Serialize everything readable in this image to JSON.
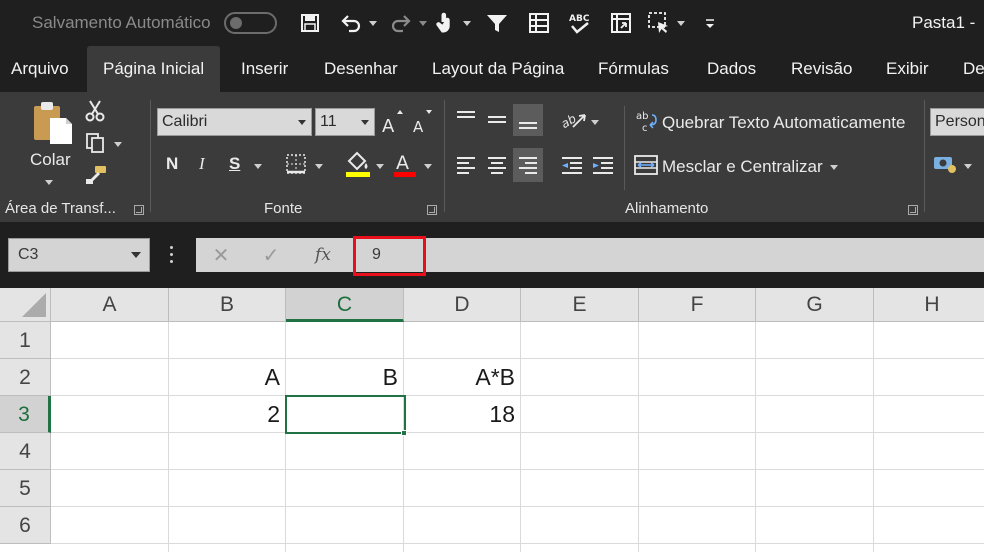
{
  "titlebar": {
    "autosave_label": "Salvamento Automático",
    "autosave_on": false,
    "window_title": "Pasta1  -",
    "icons": [
      "save-icon",
      "undo-icon",
      "redo-icon",
      "touch-mode-icon",
      "filter-icon",
      "form-icon",
      "spelling-icon",
      "pivot-icon",
      "select-objects-icon",
      "customize-qat-icon"
    ]
  },
  "tabs": [
    {
      "label": "Arquivo",
      "active": false
    },
    {
      "label": "Página Inicial",
      "active": true
    },
    {
      "label": "Inserir",
      "active": false
    },
    {
      "label": "Desenhar",
      "active": false
    },
    {
      "label": "Layout da Página",
      "active": false
    },
    {
      "label": "Fórmulas",
      "active": false
    },
    {
      "label": "Dados",
      "active": false
    },
    {
      "label": "Revisão",
      "active": false
    },
    {
      "label": "Exibir",
      "active": false
    },
    {
      "label": "De",
      "active": false
    }
  ],
  "ribbon": {
    "clipboard": {
      "paste_label": "Colar",
      "group_label": "Área de Transf..."
    },
    "font": {
      "font_name": "Calibri",
      "font_size": "11",
      "bold": "N",
      "italic": "I",
      "underline": "S",
      "group_label": "Fonte",
      "fill_color": "#ffff00",
      "font_color": "#ff0000"
    },
    "alignment": {
      "wrap_label": "Quebrar Texto Automaticamente",
      "merge_label": "Mesclar e Centralizar",
      "group_label": "Alinhamento",
      "wrap_icon_text": "ab\nc"
    },
    "number": {
      "format_value": "Person"
    }
  },
  "formula_bar": {
    "name_box": "C3",
    "cancel_symbol": "✕",
    "enter_symbol": "✓",
    "fx_label": "fx",
    "formula": "9"
  },
  "sheet": {
    "columns": [
      "A",
      "B",
      "C",
      "D",
      "E",
      "F",
      "G",
      "H"
    ],
    "rows": [
      "1",
      "2",
      "3",
      "4",
      "5",
      "6"
    ],
    "selected_column": "C",
    "selected_row": "3",
    "active_cell": "C3",
    "cells": {
      "B2": "A",
      "C2": "B",
      "D2": "A*B",
      "B3": "2",
      "C3": "",
      "D3": "18"
    }
  },
  "colors": {
    "accent_green": "#217346",
    "highlight_red": "#e8101a",
    "chrome_dark": "#1f1f1f",
    "ribbon": "#3b3b3b"
  }
}
